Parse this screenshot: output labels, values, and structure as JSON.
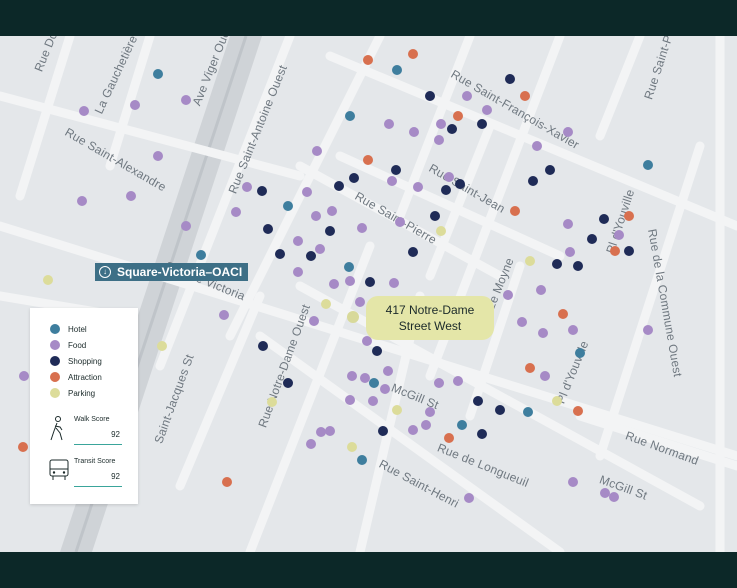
{
  "station": {
    "name": "Square-Victoria–OACI"
  },
  "location": {
    "line1": "417 Notre-Dame",
    "line2": "Street West"
  },
  "legend": {
    "items": [
      {
        "label": "Hotel",
        "color": "#3e7e9e"
      },
      {
        "label": "Food",
        "color": "#a68ac6"
      },
      {
        "label": "Shopping",
        "color": "#1f2b57"
      },
      {
        "label": "Attraction",
        "color": "#d8704f"
      },
      {
        "label": "Parking",
        "color": "#dcdc9a"
      }
    ]
  },
  "scores": {
    "walk": {
      "label": "Walk Score",
      "value": "92"
    },
    "transit": {
      "label": "Transit Score",
      "value": "92"
    }
  },
  "streets": [
    "Rue Dow",
    "La Gauchetière St",
    "Ave Viger Ouest",
    "Rue Saint-Alexandre",
    "Rue Saint-Antoine Ouest",
    "Rue Saint-François-Xavier",
    "Rue Saint-Paul",
    "Rue Saint-Jean",
    "Rue Saint-Pierre",
    "Square Victoria",
    "Rue de la Commune Ouest",
    "Pl d'Youville",
    "Rue Le Moyne",
    "McGill St",
    "Rue Notre-Dame Ouest",
    "Saint-Jacques St",
    "Rue Saint-Henri",
    "Rue de Longueuil",
    "Pl d'Youville",
    "Rue Normand",
    "McGill St"
  ]
}
